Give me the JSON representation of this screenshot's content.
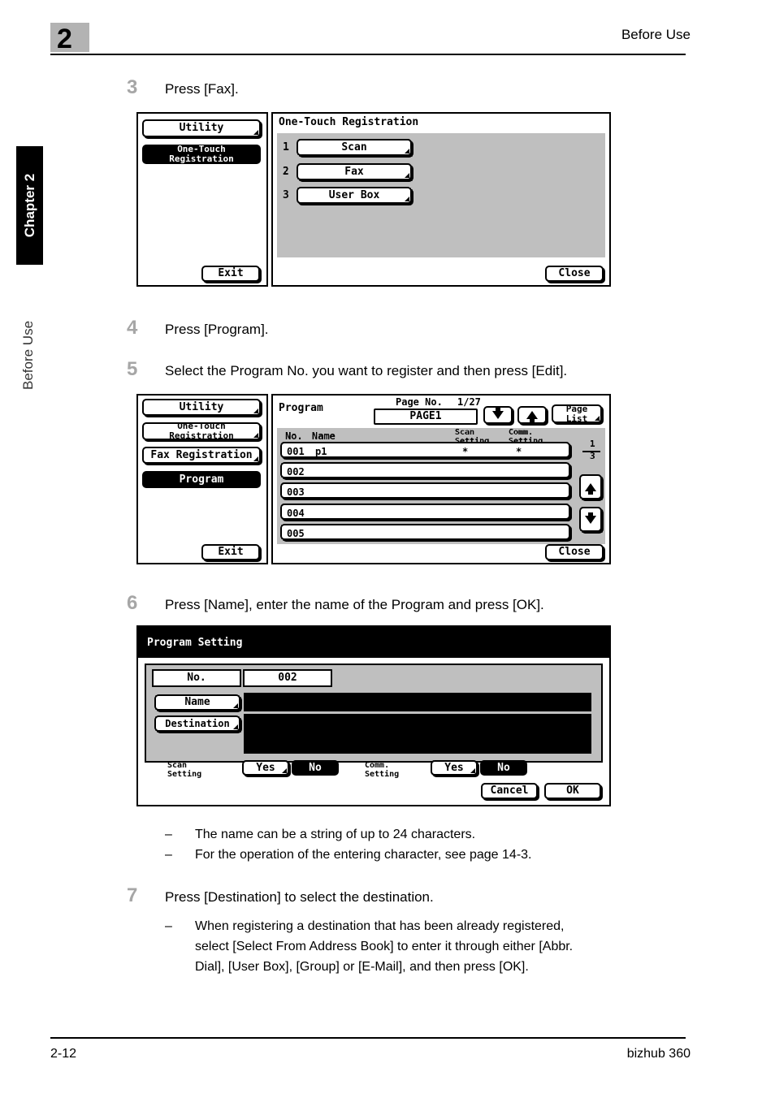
{
  "header": {
    "chapter_number": "2",
    "title": "Before Use"
  },
  "side_tab": {
    "chapter_label": "Chapter 2",
    "running_head": "Before Use"
  },
  "footer": {
    "page_number": "2-12",
    "model": "bizhub 360"
  },
  "steps": [
    {
      "num": "3",
      "text": "Press [Fax]."
    },
    {
      "num": "4",
      "text": "Press [Program]."
    },
    {
      "num": "5",
      "text": "Select the Program No. you want to register and then press [Edit]."
    },
    {
      "num": "6",
      "text": "Press [Name], enter the name of the Program and press [OK]."
    },
    {
      "num": "7",
      "text": "Press [Destination] to select the destination."
    }
  ],
  "notes_after_step6": [
    {
      "dash": "–",
      "text": "The name can be a string of up to 24 characters."
    },
    {
      "dash": "–",
      "text": "For the operation of the entering character, see page 14-3."
    }
  ],
  "notes_after_step7": [
    {
      "dash": "–",
      "line1": "When registering a destination that has been already registered,",
      "line2": "select [Select From Address Book] to enter it through either [Abbr.",
      "line3": "Dial], [User Box], [Group] or [E-Mail], and then press [OK]."
    }
  ],
  "screen_one_touch": {
    "left_menu": {
      "utility": "Utility",
      "one_touch_registration": "One-Touch\nRegistration",
      "exit": "Exit"
    },
    "panel_title": "One-Touch Registration",
    "items": [
      {
        "index": "1",
        "label": "Scan"
      },
      {
        "index": "2",
        "label": "Fax"
      },
      {
        "index": "3",
        "label": "User Box"
      }
    ],
    "close": "Close"
  },
  "screen_program_list": {
    "left_menu": {
      "utility": "Utility",
      "one_touch_registration": "One-Touch\nRegistration",
      "fax_registration": "Fax Registration",
      "program": "Program",
      "exit": "Exit"
    },
    "panel_title": "Program",
    "page_no_label": "Page No.",
    "page_no_value": "1/27",
    "page_field": "PAGE1",
    "page_list_button": "Page\nList",
    "down_arrow_icon": "arrow-down-icon",
    "up_arrow_icon": "arrow-up-icon",
    "columns": {
      "no": "No.",
      "name": "Name",
      "scan_setting": "Scan\nSetting",
      "comm_setting": "Comm.\nSetting"
    },
    "rows": [
      {
        "no": "001",
        "name": "p1",
        "scan": "*",
        "comm": "*"
      },
      {
        "no": "002",
        "name": "",
        "scan": "",
        "comm": ""
      },
      {
        "no": "003",
        "name": "",
        "scan": "",
        "comm": ""
      },
      {
        "no": "004",
        "name": "",
        "scan": "",
        "comm": ""
      },
      {
        "no": "005",
        "name": "",
        "scan": "",
        "comm": ""
      }
    ],
    "scroll_indicator_top": "1",
    "scroll_indicator_bottom": "3",
    "close": "Close"
  },
  "screen_program_setting": {
    "title": "Program Setting",
    "no_label": "No.",
    "no_value": "002",
    "name_button": "Name",
    "name_value": "",
    "destination_button": "Destination",
    "destination_value": "",
    "scan_setting_label": "Scan\nSetting",
    "scan_setting_yes": "Yes",
    "scan_setting_no": "No",
    "scan_setting_selected": "No",
    "comm_setting_label": "Comm.\nSetting",
    "comm_setting_yes": "Yes",
    "comm_setting_no": "No",
    "comm_setting_selected": "No",
    "cancel": "Cancel",
    "ok": "OK"
  }
}
